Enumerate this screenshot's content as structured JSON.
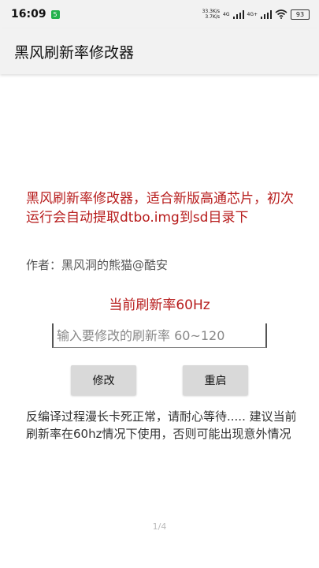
{
  "status_bar": {
    "time": "16:09",
    "notification_badge": "5",
    "speed_up": "33.3K/s",
    "speed_down": "3.7K/s",
    "network_1": "4G",
    "network_2": "4G+",
    "battery": "93"
  },
  "app_bar": {
    "title": "黑风刷新率修改器"
  },
  "main": {
    "intro": "黑风刷新率修改器，适合新版高通芯片，初次运行会自动提取dtbo.img到sd目录下",
    "author": "作者：黑风洞的熊猫@酷安",
    "current_rate": "当前刷新率60Hz",
    "rate_input": {
      "value": "",
      "placeholder": "输入要修改的刷新率 60~120"
    },
    "modify_button": "修改",
    "reboot_button": "重启",
    "note": "反编译过程漫长卡死正常，请耐心等待..... 建议当前刷新率在60hz情况下使用，否则可能出现意外情况"
  },
  "page_indicator": "1/4",
  "colors": {
    "accent_red": "#b71c1c",
    "button_bg": "#d9d9d9",
    "app_bar_bg": "#f2f2f2"
  }
}
